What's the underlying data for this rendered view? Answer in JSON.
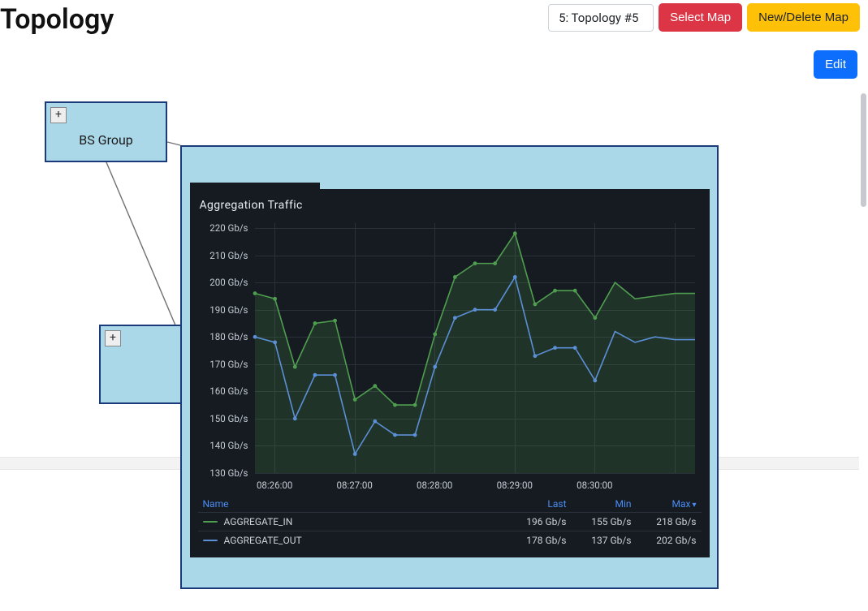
{
  "page": {
    "title": "Topology"
  },
  "controls": {
    "selected_map": "5: Topology #5",
    "select_map": "Select Map",
    "new_delete": "New/Delete Map",
    "edit": "Edit"
  },
  "nodes": {
    "a": {
      "label": "BS Group",
      "expand": "+"
    },
    "b": {
      "expand": "+"
    }
  },
  "chart_data": {
    "type": "line",
    "title": "Aggregation Traffic",
    "ylabel": "",
    "xlabel": "",
    "ylim": [
      130,
      220
    ],
    "y_ticks": [
      "220 Gb/s",
      "210 Gb/s",
      "200 Gb/s",
      "190 Gb/s",
      "180 Gb/s",
      "170 Gb/s",
      "160 Gb/s",
      "150 Gb/s",
      "140 Gb/s",
      "130 Gb/s"
    ],
    "x_ticks": [
      "08:26:00",
      "08:27:00",
      "08:28:00",
      "08:29:00",
      "08:30:00"
    ],
    "x": [
      0,
      1,
      2,
      3,
      4,
      5,
      6,
      7,
      8,
      9,
      10,
      11,
      12,
      13,
      14,
      15,
      16,
      17
    ],
    "series": [
      {
        "name": "AGGREGATE_IN",
        "color": "#4f9e4f",
        "fill": true,
        "values": [
          196,
          194,
          169,
          185,
          186,
          157,
          162,
          155,
          155,
          181,
          202,
          207,
          207,
          218,
          192,
          197,
          197,
          187
        ]
      },
      {
        "name": "AGGREGATE_OUT",
        "color": "#5b8fd6",
        "fill": false,
        "values": [
          180,
          178,
          150,
          166,
          166,
          137,
          149,
          144,
          144,
          169,
          187,
          190,
          190,
          202,
          173,
          176,
          176,
          164
        ]
      }
    ],
    "continuation_in": [
      200,
      194,
      195,
      196,
      196
    ],
    "continuation_out": [
      182,
      178,
      180,
      179,
      179
    ],
    "continuation_x": [
      18,
      19,
      20,
      21,
      22
    ],
    "legend": {
      "headers": {
        "name": "Name",
        "last": "Last",
        "min": "Min",
        "max": "Max"
      },
      "rows": [
        {
          "name": "AGGREGATE_IN",
          "last": "196 Gb/s",
          "min": "155 Gb/s",
          "max": "218 Gb/s",
          "color": "#4f9e4f"
        },
        {
          "name": "AGGREGATE_OUT",
          "last": "178 Gb/s",
          "min": "137 Gb/s",
          "max": "202 Gb/s",
          "color": "#5b8fd6"
        }
      ]
    }
  }
}
